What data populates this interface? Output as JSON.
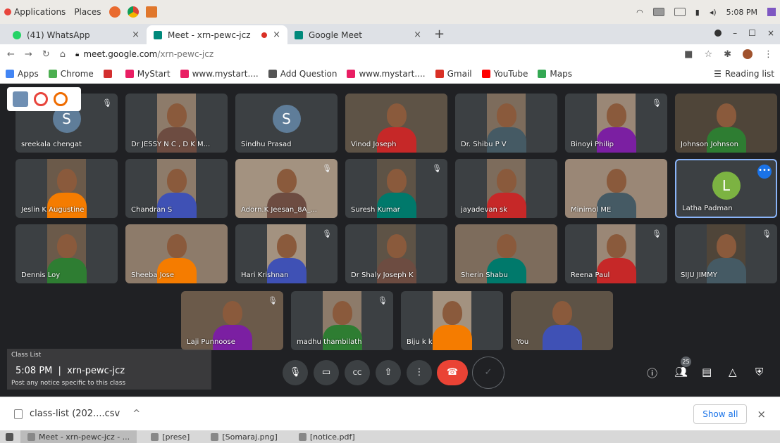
{
  "os_panel": {
    "applications": "Applications",
    "places": "Places",
    "time": "5:08 PM"
  },
  "tabs": [
    {
      "label": "(41) WhatsApp",
      "close": "×"
    },
    {
      "label": "Meet - xrn-pewc-jcz",
      "close": "×"
    },
    {
      "label": "Google Meet",
      "close": "×"
    }
  ],
  "new_tab": "+",
  "window_controls": {
    "minimize": "–",
    "maximize": "☐",
    "close": "×"
  },
  "address": {
    "domain": "meet.google.com",
    "path": "/xrn-pewc-jcz"
  },
  "bookmarks": [
    {
      "label": "Apps",
      "color": "#4285f4"
    },
    {
      "label": "Chrome",
      "color": "#4caf50"
    },
    {
      "label": "",
      "color": "#d32f2f"
    },
    {
      "label": "MyStart",
      "color": "#e91e63"
    },
    {
      "label": "www.mystart....",
      "color": "#e91e63"
    },
    {
      "label": "Add Question",
      "color": "#555555"
    },
    {
      "label": "www.mystart....",
      "color": "#e91e63"
    },
    {
      "label": "Gmail",
      "color": "#d93025"
    },
    {
      "label": "YouTube",
      "color": "#ff0000"
    },
    {
      "label": "Maps",
      "color": "#34a853"
    }
  ],
  "reading_list": "Reading list",
  "participants": [
    {
      "name": "sreekala chengat",
      "avatar": "S",
      "avatar_color": "#5f7d99",
      "muted": true
    },
    {
      "name": "Dr JESSY N C , D K M...",
      "muted": false
    },
    {
      "name": "Sindhu Prasad",
      "avatar": "S",
      "avatar_color": "#5f7d99",
      "muted": false
    },
    {
      "name": "Vinod Joseph",
      "muted": false
    },
    {
      "name": "Dr. Shibu P V",
      "muted": false
    },
    {
      "name": "Binoyi Philip",
      "muted": true
    },
    {
      "name": "Johnson Johnson",
      "muted": false
    },
    {
      "name": "Jeslin K Augustine",
      "muted": false
    },
    {
      "name": "Chandran S",
      "muted": false
    },
    {
      "name": "Adorn.K Jeesan_8A_...",
      "muted": true
    },
    {
      "name": "Suresh Kumar",
      "muted": true
    },
    {
      "name": "jayadevan sk",
      "muted": false
    },
    {
      "name": "Minimol ME",
      "muted": false
    },
    {
      "name": "Latha Padman",
      "avatar": "L",
      "avatar_color": "#7cb342",
      "muted": false
    },
    {
      "name": "Dennis Loy",
      "muted": false
    },
    {
      "name": "Sheeba Jose",
      "muted": false
    },
    {
      "name": "Hari Krishnan",
      "muted": true
    },
    {
      "name": "Dr Shaly Joseph K",
      "muted": false
    },
    {
      "name": "Sherin Shabu",
      "muted": false
    },
    {
      "name": "Reena Paul",
      "muted": true
    },
    {
      "name": "SIJU JIMMY",
      "muted": true
    },
    {
      "name": "Laji Punnoose",
      "muted": true
    },
    {
      "name": "madhu thambilath",
      "muted": true
    },
    {
      "name": "Biju k k",
      "muted": false
    },
    {
      "name": "You",
      "muted": false
    }
  ],
  "meeting": {
    "time": "5:08 PM",
    "separator": "|",
    "code": "xrn-pewc-jcz",
    "participant_count": "25"
  },
  "classlist_ghost": {
    "title": "Class List",
    "notice": "Post any notice specific to this class"
  },
  "downloads": {
    "file": "class-list (202....csv",
    "chevron": "^",
    "show_all": "Show all",
    "close": "×"
  },
  "taskbar": [
    {
      "label": "Meet - xrn-pewc-jcz - ...",
      "active": true
    },
    {
      "label": "[prese]",
      "active": false
    },
    {
      "label": "[Somaraj.png]",
      "active": false
    },
    {
      "label": "[notice.pdf]",
      "active": false
    }
  ]
}
